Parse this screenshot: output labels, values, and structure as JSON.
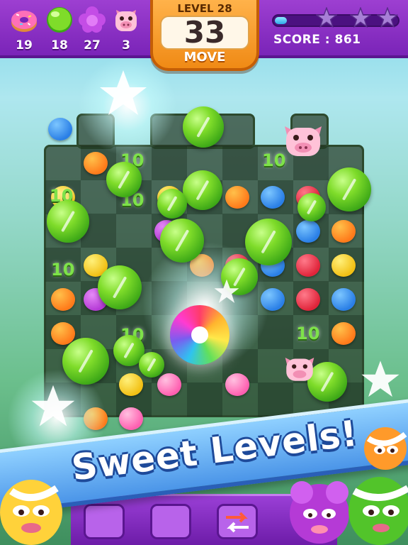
{
  "goals": [
    {
      "name": "donut-goal",
      "icon": "pink-donut-icon",
      "count": "19",
      "color": "#ff7fc0"
    },
    {
      "name": "lollipop-goal",
      "icon": "green-candy-icon",
      "count": "18",
      "color": "#6fd22a"
    },
    {
      "name": "flower-goal",
      "icon": "purple-flower-candy-icon",
      "count": "27",
      "color": "#c44de6"
    },
    {
      "name": "pig-goal",
      "icon": "pig-icon",
      "count": "3",
      "color": "#ffc2d8"
    }
  ],
  "level": {
    "label": "LEVEL 28",
    "moves": "33",
    "moves_label": "MOVE"
  },
  "score": {
    "text": "SCORE : 861",
    "progress": 0.1,
    "stars_earned": 0,
    "stars_total": 3
  },
  "board": {
    "bonus_label": "10"
  },
  "banner": {
    "text": "Sweet Levels!"
  },
  "colors": {
    "topbar": "#8a2fc6",
    "level_panel": "#f59a22",
    "banner": "#5aa4f0",
    "bonus_text": "#7ee24a"
  }
}
